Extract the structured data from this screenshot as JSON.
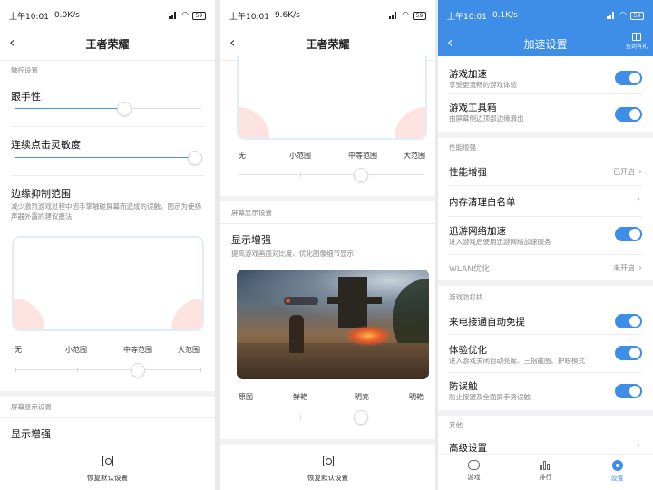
{
  "screen1": {
    "status": {
      "time": "上午10:01",
      "speed": "0.0K/s",
      "battery": "59"
    },
    "nav": {
      "title": "王者荣耀"
    },
    "section_touch": "触控设置",
    "follow": {
      "title": "跟手性",
      "value_percent": 55
    },
    "continuous": {
      "title": "连续点击灵敏度",
      "value_percent": 100
    },
    "edge": {
      "title": "边缘抑制范围",
      "desc": "减少激烈游戏过程中因手掌触碰屏幕而造成的误触，图示为使扬声器外露的建议握法"
    },
    "range_labels": [
      "无",
      "小范围",
      "中等范围",
      "大范围"
    ],
    "range_value_index": 2,
    "section_display": "屏幕显示设置",
    "display": {
      "title": "显示增强"
    },
    "reset_label": "恢复默认设置"
  },
  "screen2": {
    "status": {
      "time": "上午10:01",
      "speed": "9.6K/s",
      "battery": "59"
    },
    "nav": {
      "title": "王者荣耀"
    },
    "range_labels": [
      "无",
      "小范围",
      "中等范围",
      "大范围"
    ],
    "range_value_index": 2,
    "section_display": "屏幕显示设置",
    "display": {
      "title": "显示增强",
      "desc": "提高游戏画面对比度、优化图像细节显示"
    },
    "enhance_labels": [
      "原图",
      "鲜艳",
      "明亮",
      "明艳"
    ],
    "enhance_value_index": 2,
    "reset_label": "恢复默认设置"
  },
  "screen3": {
    "status": {
      "time": "上午10:01",
      "speed": "0.1K/s",
      "battery": "59"
    },
    "nav": {
      "title": "加速设置"
    },
    "gift_label": "签到有礼",
    "accent": "#3e8de6",
    "rows_top": [
      {
        "title": "游戏加速",
        "desc": "享受更流畅的游戏体验",
        "on": true
      },
      {
        "title": "游戏工具箱",
        "desc": "由屏幕侧边顶部边缘滑出",
        "on": true
      }
    ],
    "section_perf": "性能增强",
    "perf_rows": [
      {
        "title": "性能增强",
        "value": "已开启"
      },
      {
        "title": "内存清理白名单"
      }
    ],
    "xunyou": {
      "title": "迅游网络加速",
      "desc": "进入游戏后使用迅游网络加速服务",
      "on": true
    },
    "wlan": {
      "title": "WLAN优化",
      "value": "未开启"
    },
    "section_noise": "游戏防打扰",
    "noise_rows": [
      {
        "title": "来电接通自动免提",
        "on": true
      },
      {
        "title": "体验优化",
        "desc": "进入游戏关闭自动亮度、三指截图、护眼模式",
        "on": true
      },
      {
        "title": "防误触",
        "desc": "防止按键及全面屏手势误触",
        "on": true
      }
    ],
    "section_other": "其他",
    "advanced": {
      "title": "高级设置"
    },
    "tabs": [
      {
        "label": "游戏",
        "icon": "gamepad-icon"
      },
      {
        "label": "排行",
        "icon": "ranking-icon"
      },
      {
        "label": "设置",
        "icon": "settings-icon"
      }
    ]
  }
}
